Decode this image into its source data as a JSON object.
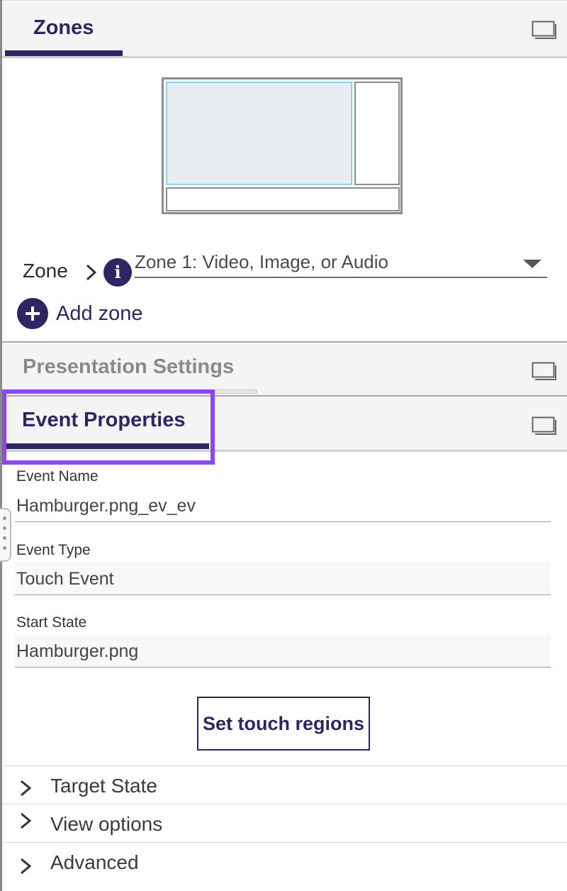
{
  "zones_panel": {
    "title": "Zones",
    "zone_label": "Zone",
    "zone_select_value": "Zone 1: Video, Image, or Audio",
    "add_zone_label": "Add zone"
  },
  "presentation_panel": {
    "title": "Presentation Settings"
  },
  "event_panel": {
    "title": "Event Properties",
    "fields": {
      "event_name": {
        "label": "Event Name",
        "value": "Hamburger.png_ev_ev"
      },
      "event_type": {
        "label": "Event Type",
        "value": "Touch Event"
      },
      "start_state": {
        "label": "Start State",
        "value": "Hamburger.png"
      }
    },
    "touch_button_label": "Set touch regions",
    "sections": [
      "Target State",
      "View options",
      "Advanced"
    ]
  },
  "icons": {
    "window": "window-icon",
    "info": "info-icon",
    "add": "plus-circle-icon",
    "chevron": "chevron-right-icon",
    "dropdown": "caret-down-icon",
    "grip": "resize-grip-icon"
  },
  "colors": {
    "accent": "#2e2663",
    "highlight": "#8b46ff",
    "selected_zone_fill": "#e8ebf0",
    "selected_zone_border": "#8fd3f0"
  }
}
